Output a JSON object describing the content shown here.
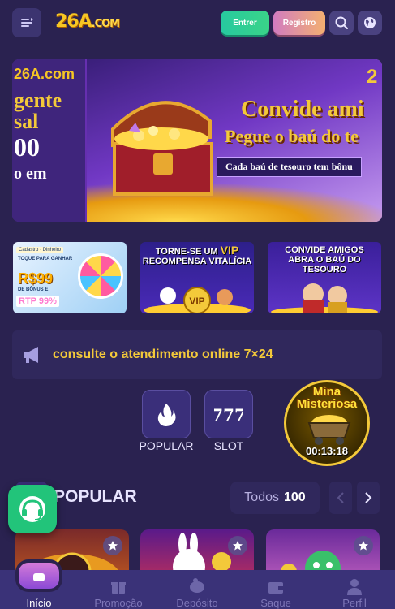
{
  "header": {
    "logo_text": "26A",
    "logo_suffix": ".COM",
    "login_label": "Entrer",
    "register_label": "Registro"
  },
  "banner": {
    "left_logo": "26A.com",
    "left_line1": "gente",
    "left_line2": "sal",
    "left_line3": "00",
    "left_line4": "o em",
    "corner_text": "2",
    "title_line1": "Convide ami",
    "title_line2": "Pegue o baú do te",
    "subtitle": "Cada baú de tesouro tem bônu"
  },
  "promos": [
    {
      "small": "Cadastro · Dinheiro",
      "caption": "TOQUE PARA GANHAR",
      "amount": "R$99",
      "bonus": "DE BÔNUS E",
      "rtp": "RTP 99%"
    },
    {
      "title_pre": "TORNE-SE UM",
      "title_vip": "VIP",
      "title_post": "RECOMPENSA VITALÍCIA"
    },
    {
      "title": "CONVIDE AMIGOS ABRA O BAÚ DO TESOURO"
    }
  ],
  "marquee": {
    "text": "consulte o atendimento online 7×24"
  },
  "categories": [
    {
      "label": "POPULAR"
    },
    {
      "label": "SLOT"
    }
  ],
  "mystery": {
    "title_line1": "Mina",
    "title_line2": "Misteriosa",
    "timer": "00:13:18"
  },
  "popular": {
    "title": "POPULAR",
    "all_label": "Todos",
    "count": "100"
  },
  "bottom_nav": [
    {
      "label": "Início",
      "active": true
    },
    {
      "label": "Promoção",
      "active": false
    },
    {
      "label": "Depósito",
      "active": false
    },
    {
      "label": "Saque",
      "active": false
    },
    {
      "label": "Perfil",
      "active": false
    }
  ],
  "colors": {
    "background": "#2a2250",
    "accent_gold": "#f3c93a",
    "login_green": "#27c9a0",
    "support_green": "#22c47a",
    "nav_bg": "#3a3278"
  }
}
